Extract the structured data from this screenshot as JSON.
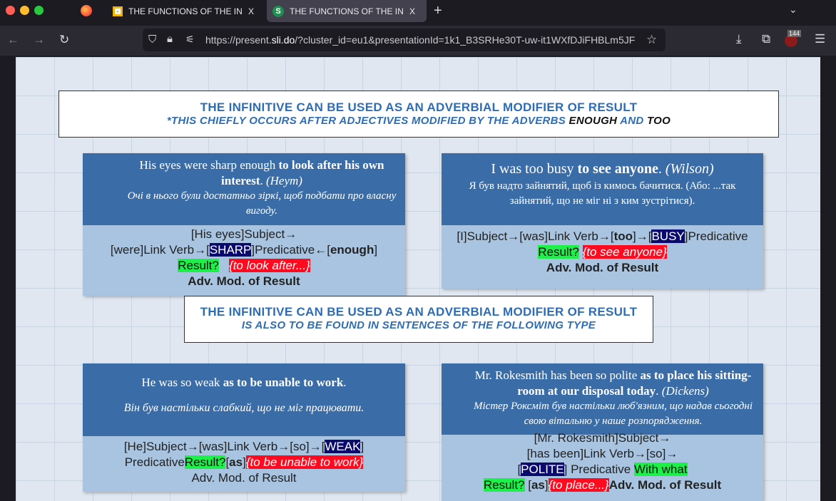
{
  "browser": {
    "tabs": [
      {
        "title": "THE FUNCTIONS OF THE INFINI",
        "close": "X"
      },
      {
        "title": "THE FUNCTIONS OF THE INFINI",
        "close": "X",
        "favicon": "S"
      }
    ],
    "new_tab": "+",
    "url_prefix": "https://present.",
    "url_domain": "sli.do",
    "url_rest": "/?cluster_id=eu1&presentationId=1k1_B3SRHe30T-uw-it1WXfDJiFHBLm5JF",
    "badge": "144"
  },
  "slide": {
    "header1": {
      "line1": "THE INFINITIVE CAN BE  USED AS AN ADVERBIAL MODIFIER OF RESULT",
      "line2a": "*THIS CHIEFLY OCCURS AFTER ADJECTIVES MODIFIED BY THE ADVERBS ",
      "enough": "ENOUGH",
      "and": " AND ",
      "too": "TOO"
    },
    "header2": {
      "line1": "THE INFINITIVE CAN BE  USED AS AN ADVERBIAL MODIFIER OF RESULT",
      "line2": "IS ALSO TO BE FOUND IN SENTENCES OF THE FOLLOWING TYPE"
    },
    "card1": {
      "s1": "His eyes were sharp enough ",
      "s2": "to look after his own interest",
      "s3": ". ",
      "author": "(Неут)",
      "ua": "Очі в нього були достатньо зіркі, щоб подбати про власну вигоду.",
      "a1": "[His eyes]Subject→",
      "a2": "[were]Link Verb→[",
      "w": "SHARP",
      "a3": "]Predicative←[",
      "enough": "enough",
      "a4": "]",
      "result": "Result?",
      "inf": "{to look after...}",
      "adv": "Adv. Mod. of Result"
    },
    "card2": {
      "s1": "I was too busy ",
      "s2": "to see anyone",
      "s3": ". ",
      "author": "(Wilson)",
      "ua": "Я був надто зайнятий, щоб із кимось бачитися. (Або: ...так зайнятий, що не міг ні з ким зустрітися).",
      "a1": "[I]Subject→[was]Link Verb→[",
      "too": "too",
      "a2": "]→[",
      "w": "BUSY",
      "a3": "]Predicative",
      "result": "Result?",
      "inf": "{to see anyone}",
      "adv": "Adv. Mod. of Result"
    },
    "card3": {
      "s1": "He was so weak ",
      "s2": "as to be unable to work",
      "s3": ".",
      "ua": "Він був настільки слабкий, що не міг працювати.",
      "a1": "[He]Subject→[was]Link Verb→[so]→[",
      "w": "WEAK",
      "a2": "]",
      "a3": "Predicative",
      "result": "Result?",
      "a4": "[",
      "as": "as",
      "a5": "]",
      "inf": "{to be unable to work}",
      "adv": "Adv. Mod. of Result"
    },
    "card4": {
      "s1": "Mr. Rokesmith has been so polite ",
      "s2": "as to place his sitting-room at our disposal today",
      "s3": ". ",
      "author": "(Dickens)",
      "ua": "Містер Роксміт був настільки люб'язним, що надав сьогодні свою вітальню у наше розпорядження.",
      "a1": "[Mr. Rokesmith]Subject→",
      "a2": "[has been]Link Verb→[so]→",
      "a3": "[",
      "w": "POLITE",
      "a4": "] Predicative ",
      "with": "With what",
      "result": "Result?",
      "a5": " [",
      "as": "as",
      "a6": "]",
      "inf": "{to place...}",
      "adv": "Adv. Mod. of Result"
    }
  }
}
